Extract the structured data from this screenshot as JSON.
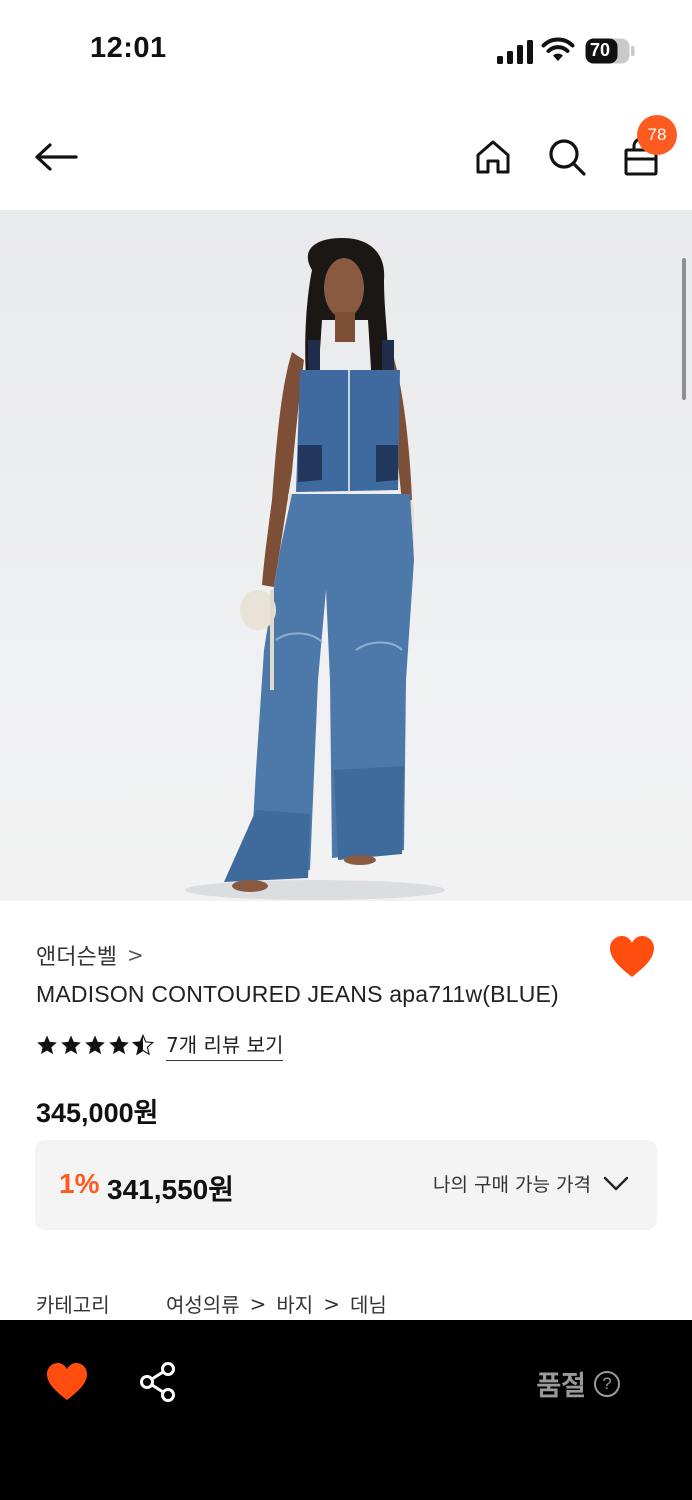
{
  "status_bar": {
    "time": "12:01",
    "battery": "70"
  },
  "nav": {
    "cart_count": "78"
  },
  "product": {
    "brand": "앤더슨벨",
    "brand_chevron": ">",
    "title": "MADISON CONTOURED JEANS apa711w(BLUE)",
    "rating": 4.5,
    "review_link": "7개 리뷰 보기",
    "original_price": "345,000원",
    "discount_rate": "1%",
    "discount_price": "341,550원",
    "my_price_label": "나의 구매 가능 가격",
    "category_label": "카테고리",
    "categories": [
      "여성의류",
      "바지",
      "데님"
    ],
    "category_sep": ">",
    "wishlisted": true
  },
  "bottom_bar": {
    "soldout_label": "품절",
    "help_glyph": "?"
  },
  "colors": {
    "accent": "#ff5a1f",
    "bottom_bar_bg": "#000000",
    "price_box_bg": "#f4f4f5",
    "soldout_text": "#9a9a9a"
  }
}
